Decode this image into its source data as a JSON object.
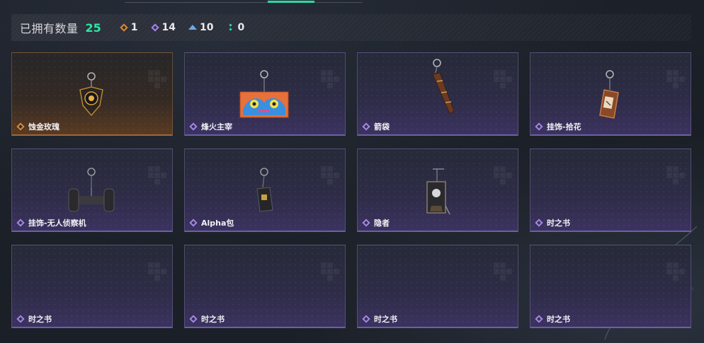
{
  "summary": {
    "owned_label": "已拥有数量",
    "owned_total": "25",
    "rarity_counts": [
      {
        "icon": "orange-diamond-icon",
        "color": "#d98a3b",
        "count": "1"
      },
      {
        "icon": "purple-diamond-icon",
        "color": "#a586e8",
        "count": "14"
      },
      {
        "icon": "blue-chevron-icon",
        "color": "#6ea8e8",
        "count": "10"
      },
      {
        "icon": "teal-dots-icon",
        "color": "#34d6b0",
        "count": "0"
      }
    ]
  },
  "items": [
    {
      "name": "蚀金玫瑰",
      "rarity": "orange",
      "art": "rose-pendant"
    },
    {
      "name": "烽火主宰",
      "rarity": "purple",
      "art": "graffiti-container"
    },
    {
      "name": "箭袋",
      "rarity": "purple",
      "art": "quiver"
    },
    {
      "name": "挂饰-拾花",
      "rarity": "purple",
      "art": "framed-tag"
    },
    {
      "name": "挂饰-无人侦察机",
      "rarity": "purple",
      "art": "drone-roller"
    },
    {
      "name": "Alpha包",
      "rarity": "purple",
      "art": "alpha-bag"
    },
    {
      "name": "隐者",
      "rarity": "purple",
      "art": "hermit-card"
    },
    {
      "name": "时之书",
      "rarity": "purple",
      "art": "none"
    },
    {
      "name": "时之书",
      "rarity": "purple",
      "art": "none"
    },
    {
      "name": "时之书",
      "rarity": "purple",
      "art": "none"
    },
    {
      "name": "时之书",
      "rarity": "purple",
      "art": "none"
    },
    {
      "name": "时之书",
      "rarity": "purple",
      "art": "none"
    }
  ],
  "colors": {
    "accent": "#2fe6a4",
    "legendary": "#d98a3b",
    "epic": "#a586e8"
  }
}
